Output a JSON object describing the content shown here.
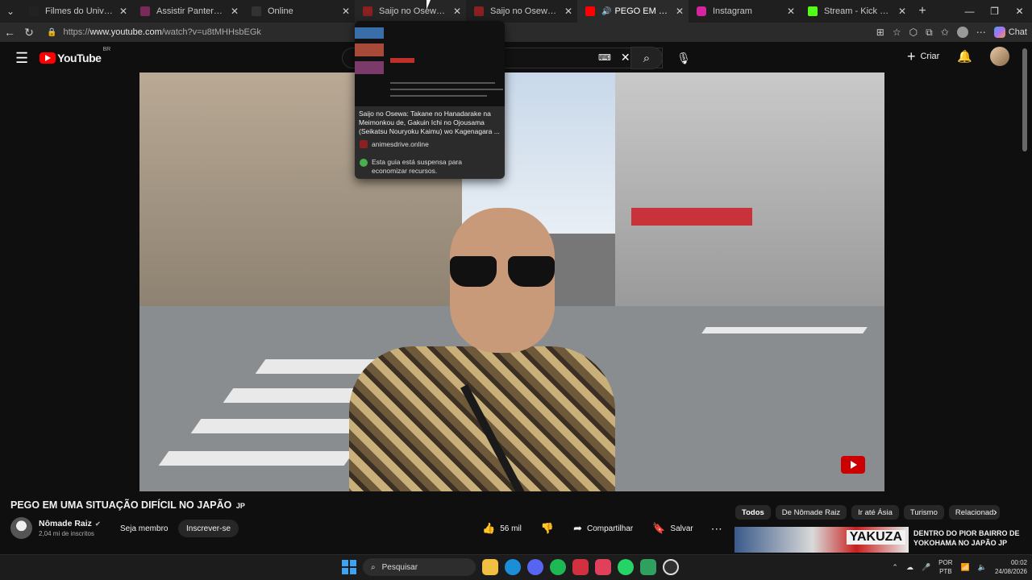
{
  "browser": {
    "tabs": [
      {
        "label": "Filmes do Universo Marvel",
        "color": "#222222"
      },
      {
        "label": "Assistir Pantera Negra: Wakanda",
        "color": "#7a2a5a"
      },
      {
        "label": "Online",
        "color": "#333333"
      },
      {
        "label": "Saijo no Osewa: Takane no",
        "color": "#8a2020"
      },
      {
        "label": "Saijo no Osewa: Takane no",
        "color": "#8a2020"
      },
      {
        "label": "PEGO EM UMA SITUAÇÃO",
        "color": "#ff0000"
      },
      {
        "label": "Instagram",
        "color": "#d6249f"
      },
      {
        "label": "Stream - Kick Dashboard",
        "color": "#53fc18"
      }
    ],
    "url_prefix": "https://",
    "url_host": "www.youtube.com",
    "url_path": "/watch?v=u8tMHHsbEGk",
    "copilot_label": "Chat"
  },
  "tab_preview": {
    "title": "Saijo no Osewa: Takane no Hanadarake na Meimonkou de, Gakuin Ichi no Ojousama (Seikatsu Nouryoku Kaimu) wo Kagenagara ...",
    "site": "animesdrive.online",
    "sleep_note": "Esta guia está suspensa para economizar recursos."
  },
  "youtube": {
    "logo_text": "YouTube",
    "region": "BR",
    "create_label": "Criar"
  },
  "video": {
    "title": "PEGO EM UMA SITUAÇÃO DIFÍCIL NO JAPÃO",
    "title_flag": "JP",
    "channel_name": "Nômade Raiz",
    "subscribers": "2,04 mi de inscritos",
    "join_label": "Seja membro",
    "subscribe_label": "Inscrever-se",
    "likes": "56 mil",
    "share_label": "Compartilhar",
    "save_label": "Salvar"
  },
  "chips": [
    "Todos",
    "De Nômade Raiz",
    "Ir até Ásia",
    "Turismo",
    "Relacionad"
  ],
  "recommendation": {
    "thumb_text": "YAKUZA",
    "title_line1": "DENTRO DO PIOR BAIRRO DE",
    "title_line2": "YOKOHAMA NO JAPÃO JP"
  },
  "taskbar": {
    "search_label": "Pesquisar",
    "lang_line1": "POR",
    "lang_line2": "PTB",
    "time": "00:02",
    "date": "24/08/2026"
  }
}
